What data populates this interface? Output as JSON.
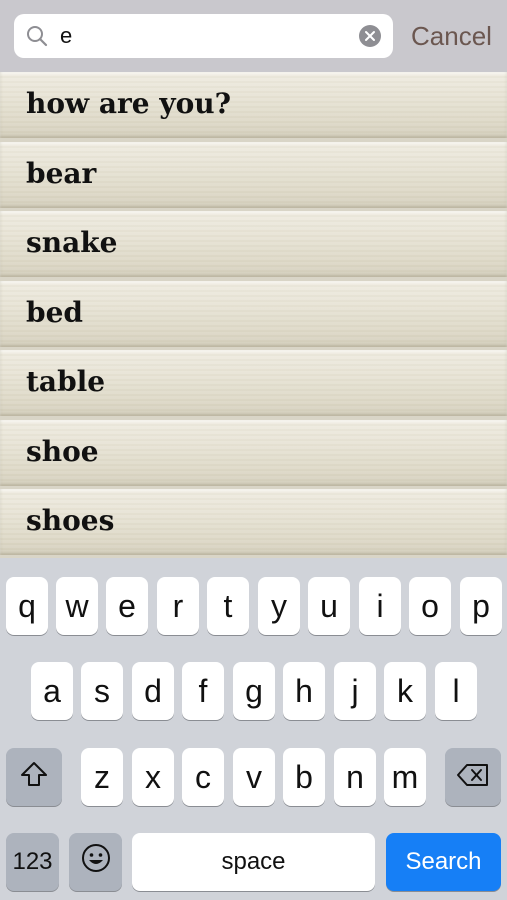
{
  "search": {
    "value": "e",
    "cancel_label": "Cancel"
  },
  "results": [
    "how are you?",
    "bear",
    "snake",
    "bed",
    "table",
    "shoe",
    "shoes"
  ],
  "keyboard": {
    "row1": [
      "q",
      "w",
      "e",
      "r",
      "t",
      "y",
      "u",
      "i",
      "o",
      "p"
    ],
    "row2": [
      "a",
      "s",
      "d",
      "f",
      "g",
      "h",
      "j",
      "k",
      "l"
    ],
    "row3": [
      "z",
      "x",
      "c",
      "v",
      "b",
      "n",
      "m"
    ],
    "numbers_label": "123",
    "space_label": "space",
    "search_label": "Search"
  }
}
